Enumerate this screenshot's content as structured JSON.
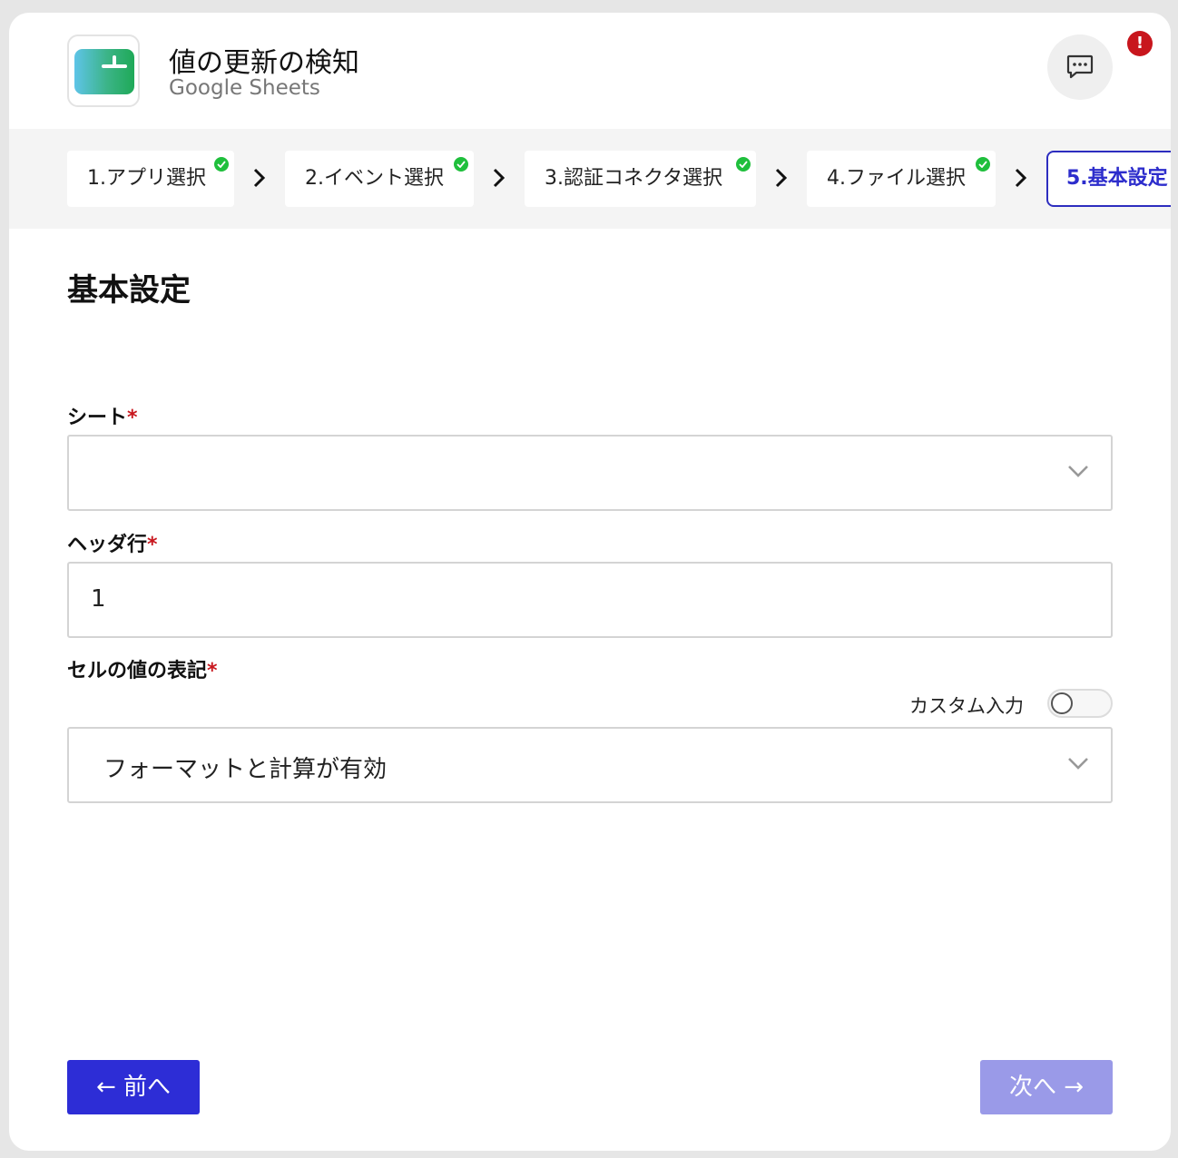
{
  "header": {
    "title": "値の更新の検知",
    "subtitle": "Google Sheets",
    "chat_icon": "chat-bubble-icon",
    "alert_badge": "!"
  },
  "stepper": {
    "steps": [
      {
        "label": "1.アプリ選択",
        "completed": true
      },
      {
        "label": "2.イベント選択",
        "completed": true
      },
      {
        "label": "3.認証コネクタ選択",
        "completed": true
      },
      {
        "label": "4.ファイル選択",
        "completed": true
      },
      {
        "label": "5.基本設定",
        "completed": false,
        "active": true
      }
    ]
  },
  "main": {
    "section_title": "基本設定",
    "fields": {
      "sheet": {
        "label": "シート",
        "required_mark": "*",
        "value": ""
      },
      "header_row": {
        "label": "ヘッダ行",
        "required_mark": "*",
        "value": "1"
      },
      "cell_format": {
        "label": "セルの値の表記",
        "required_mark": "*",
        "custom_toggle_label": "カスタム入力",
        "custom_toggle_on": false,
        "value": "フォーマットと計算が有効"
      }
    }
  },
  "footer": {
    "prev_label": "← 前へ",
    "next_label": "次へ →"
  },
  "colors": {
    "primary": "#2d2dd6",
    "primary_disabled": "#9a9ae8",
    "required": "#c8161d",
    "check": "#1fbf3c"
  }
}
